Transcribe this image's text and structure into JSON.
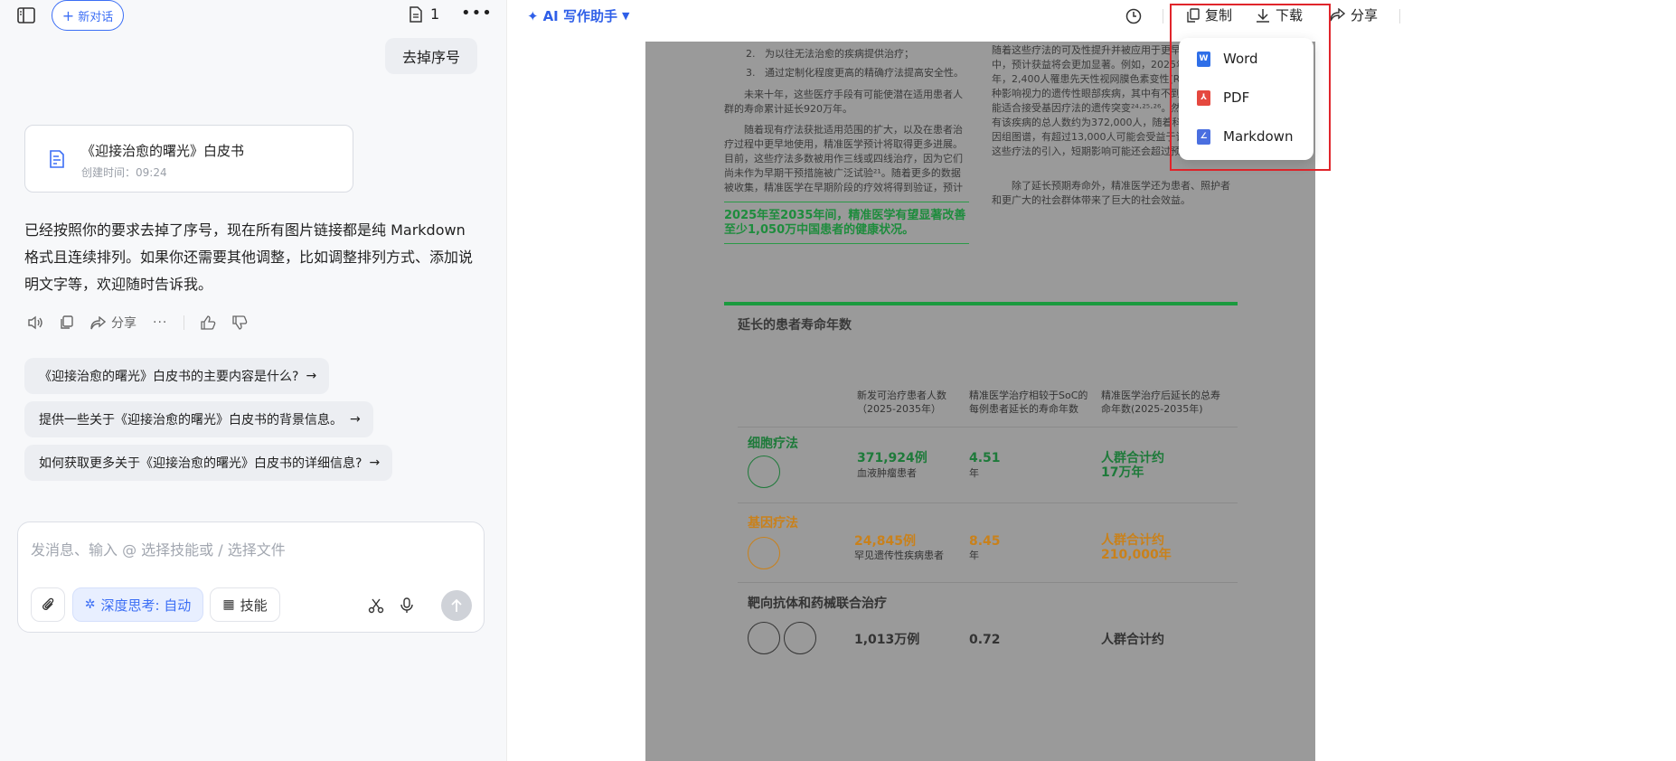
{
  "left": {
    "new_chat_label": "新对话",
    "doc_count": "1",
    "user_message": "去掉序号",
    "doc_card": {
      "title": "《迎接治愈的曙光》白皮书",
      "created": "创建时间：09:24"
    },
    "answer": "已经按照你的要求去掉了序号，现在所有图片链接都是纯 Markdown 格式且连续排列。如果你还需要其他调整，比如调整排列方式、添加说明文字等，欢迎随时告诉我。",
    "actions": {
      "share": "分享",
      "more": "···"
    },
    "suggestions": [
      "《迎接治愈的曙光》白皮书的主要内容是什么?",
      "提供一些关于《迎接治愈的曙光》白皮书的背景信息。",
      "如何获取更多关于《迎接治愈的曙光》白皮书的详细信息?"
    ],
    "composer": {
      "placeholder": "发消息、输入 @ 选择技能或 / 选择文件",
      "deep_think": "深度思考: 自动",
      "skills": "技能"
    }
  },
  "right": {
    "title": "AI 写作助手",
    "copy": "复制",
    "download": "下载",
    "share": "分享",
    "download_menu": [
      {
        "label": "Word",
        "icon": "word-file-icon",
        "color": "#2f6fe8",
        "glyph": "W"
      },
      {
        "label": "PDF",
        "icon": "pdf-file-icon",
        "color": "#e5483f",
        "glyph": "⅄"
      },
      {
        "label": "Markdown",
        "icon": "markdown-file-icon",
        "color": "#4a6fe0",
        "glyph": "∠"
      }
    ],
    "doc": {
      "list_items": [
        "2.   为以往无法治愈的疾病提供治疗；",
        "3.   通过定制化程度更高的精确疗法提高安全性。"
      ],
      "para1": "未来十年，这些医疗手段有可能使潜在适用患者人群的寿命累计延长920万年。",
      "para2": "随着现有疗法获批适用范围的扩大，以及在患者治疗过程中更早地使用，精准医学预计将取得更多进展。目前，这些疗法多数被用作三线或四线治疗，因为它们尚未作为早期干预措施被广泛试验²¹。随着更多的数据被收集，精准医学在早期阶段的疗效将得到验证，预计",
      "right_col1": "随着这些疗法的可及性提升并被应用于更早期的治疗中，预计获益将会更加显著。例如，2025年至2035年，2,400人罹患先天性视网膜色素变性(RP)，这是一种影响视力的遗传性眼部疾病，其中有不到8%的患者可能适合接受基因疗法的遗传突变²⁴·²⁵·²⁶。然而，中国患有该疾病的总人数约为372,000人，随着科学进步和基因组图谱，有超过13,000人可能会受益于该疗法。随着这些疗法的引入，短期影响可能还会超过预测²⁷。",
      "right_col2": "除了延长预期寿命外，精准医学还为患者、照护者和更广大的社会群体带来了巨大的社会效益。",
      "quote": "2025年至2035年间，精准医学有望显著改善至少1,050万中国患者的健康状况。",
      "section_title": "延长的患者寿命年数",
      "col_heads": [
        "新发可治疗患者人数（2025-2035年）",
        "精准医学治疗相较于SoC的每例患者延长的寿命年数",
        "精准医学治疗后延长的总寿命年数(2025-2035年)"
      ],
      "rows": [
        {
          "name": "细胞疗法",
          "color": "#1e7a3a",
          "patients": "371,924例",
          "patients_sub": "血液肿瘤患者",
          "years": "4.51",
          "years_sub": "年",
          "total1": "人群合计约",
          "total2": "17万年",
          "icon": "cell-therapy-icon"
        },
        {
          "name": "基因疗法",
          "color": "#c9811b",
          "patients": "24,845例",
          "patients_sub": "罕见遗传性疾病患者",
          "years": "8.45",
          "years_sub": "年",
          "total1": "人群合计约",
          "total2": "210,000年",
          "icon": "dna-icon"
        },
        {
          "name": "靶向抗体和药械联合治疗",
          "color": "#333333",
          "patients": "1,013万例",
          "patients_sub": "",
          "years": "0.72",
          "years_sub": "",
          "total1": "人群合计约",
          "total2": "",
          "icon": "antibody-icon"
        }
      ]
    }
  }
}
